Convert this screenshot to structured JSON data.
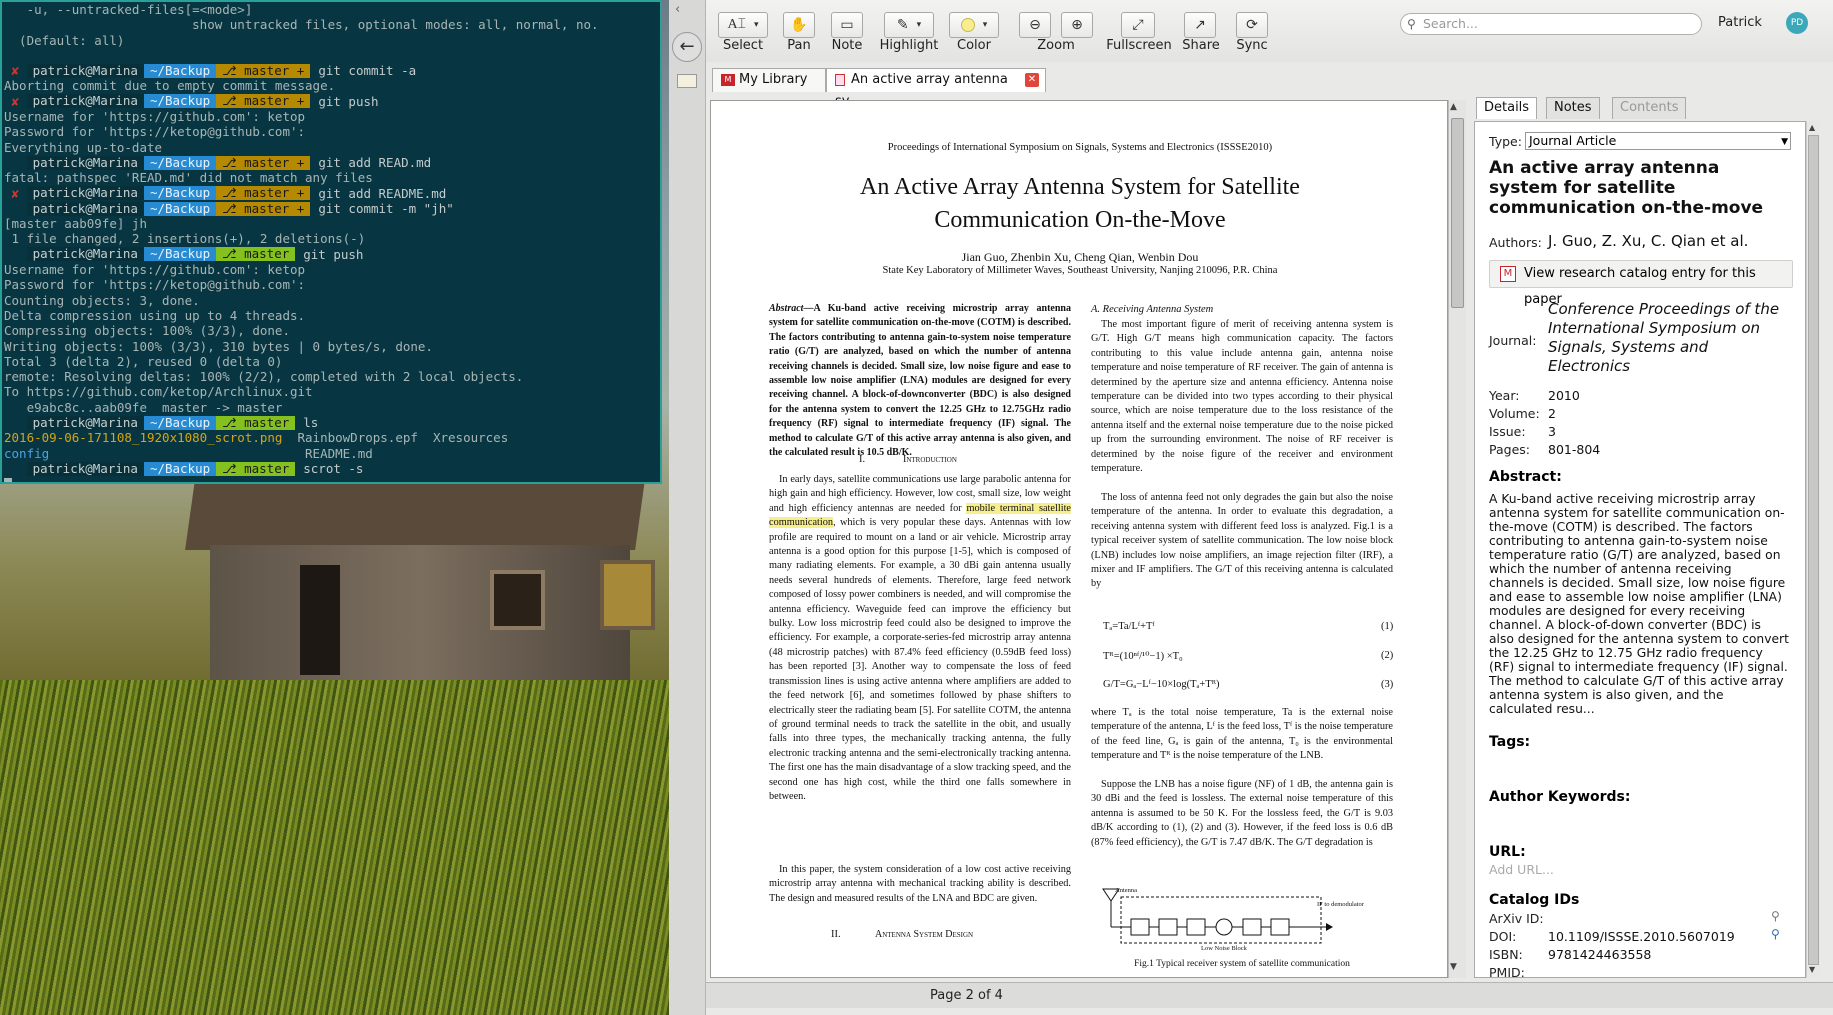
{
  "terminal": {
    "lines": [
      {
        "t": "plain",
        "text": "   -u, --untracked-files[=<mode>]"
      },
      {
        "t": "plain",
        "text": "                         show untracked files, optional modes: all, normal, no."
      },
      {
        "t": "plain",
        "text": "  (Default: all)"
      },
      {
        "t": "plain",
        "text": ""
      },
      {
        "t": "prompt",
        "x": true,
        "user": "patrick@Marina",
        "dir": "~/Backup",
        "branch": "master +",
        "dirty": true,
        "cmd": "git commit -a"
      },
      {
        "t": "plain",
        "text": "Aborting commit due to empty commit message."
      },
      {
        "t": "prompt",
        "x": true,
        "user": "patrick@Marina",
        "dir": "~/Backup",
        "branch": "master +",
        "dirty": true,
        "cmd": "git push"
      },
      {
        "t": "plain",
        "text": "Username for 'https://github.com': ketop"
      },
      {
        "t": "plain",
        "text": "Password for 'https://ketop@github.com':"
      },
      {
        "t": "plain",
        "text": "Everything up-to-date"
      },
      {
        "t": "prompt",
        "x": false,
        "user": "patrick@Marina",
        "dir": "~/Backup",
        "branch": "master +",
        "dirty": true,
        "cmd": "git add READ.md"
      },
      {
        "t": "plain",
        "text": "fatal: pathspec 'READ.md' did not match any files"
      },
      {
        "t": "prompt",
        "x": true,
        "user": "patrick@Marina",
        "dir": "~/Backup",
        "branch": "master +",
        "dirty": true,
        "cmd": "git add README.md"
      },
      {
        "t": "prompt",
        "x": false,
        "user": "patrick@Marina",
        "dir": "~/Backup",
        "branch": "master +",
        "dirty": true,
        "cmd": "git commit -m \"jh\""
      },
      {
        "t": "plain",
        "text": "[master aab09fe] jh"
      },
      {
        "t": "plain",
        "text": " 1 file changed, 2 insertions(+), 2 deletions(-)"
      },
      {
        "t": "prompt",
        "x": false,
        "user": "patrick@Marina",
        "dir": "~/Backup",
        "branch": "master",
        "dirty": false,
        "cmd": "git push"
      },
      {
        "t": "plain",
        "text": "Username for 'https://github.com': ketop"
      },
      {
        "t": "plain",
        "text": "Password for 'https://ketop@github.com':"
      },
      {
        "t": "plain",
        "text": "Counting objects: 3, done."
      },
      {
        "t": "plain",
        "text": "Delta compression using up to 4 threads."
      },
      {
        "t": "plain",
        "text": "Compressing objects: 100% (3/3), done."
      },
      {
        "t": "plain",
        "text": "Writing objects: 100% (3/3), 310 bytes | 0 bytes/s, done."
      },
      {
        "t": "plain",
        "text": "Total 3 (delta 2), reused 0 (delta 0)"
      },
      {
        "t": "plain",
        "text": "remote: Resolving deltas: 100% (2/2), completed with 2 local objects."
      },
      {
        "t": "plain",
        "text": "To https://github.com/ketop/Archlinux.git"
      },
      {
        "t": "plain",
        "text": "   e9abc8c..aab09fe  master -> master"
      },
      {
        "t": "prompt",
        "x": false,
        "user": "patrick@Marina",
        "dir": "~/Backup",
        "branch": "master",
        "dirty": false,
        "cmd": "ls"
      },
      {
        "t": "ls1",
        "a": "2016-09-06-171108_1920x1080_scrot.png",
        "b": "  RainbowDrops.epf  Xresources"
      },
      {
        "t": "ls2",
        "a": "config",
        "b": "                                  README.md"
      },
      {
        "t": "prompt",
        "x": false,
        "user": "patrick@Marina",
        "dir": "~/Backup",
        "branch": "master",
        "dirty": false,
        "cmd": "scrot -s"
      },
      {
        "t": "cursor"
      }
    ]
  },
  "toolbar": {
    "select": "Select",
    "pan": "Pan",
    "note": "Note",
    "highlight": "Highlight",
    "color": "Color",
    "zoom": "Zoom",
    "fullscreen": "Fullscreen",
    "share": "Share",
    "sync": "Sync",
    "search_placeholder": "Search...",
    "user": "Patrick",
    "user_initials": "PD"
  },
  "tabs": {
    "library": "My Library",
    "document": "An active array antenna sy..."
  },
  "status": {
    "page": "Page 2 of 4"
  },
  "paper": {
    "venue": "Proceedings of International Symposium on Signals, Systems and Electronics  (ISSSE2010)",
    "title1": "An Active Array Antenna System for Satellite",
    "title2": "Communication On-the-Move",
    "authors": "Jian Guo, Zhenbin Xu, Cheng Qian, Wenbin Dou",
    "affil": "State Key Laboratory of Millimeter Waves, Southeast University, Nanjing 210096, P.R. China",
    "abstract_lead": "Abstract",
    "abstract": "A Ku-band active receiving microstrip array antenna system for satellite communication on-the-move (COTM) is described.  The factors contributing to antenna gain-to-system noise temperature ratio (G/T) are analyzed, based on which the number of antenna receiving channels is decided.  Small size, low noise figure and ease to assemble low noise amplifier (LNA) modules are designed for every receiving channel.  A block-of-downconverter (BDC) is also designed for the antenna system to convert the 12.25 GHz to 12.75GHz radio frequency (RF) signal to intermediate frequency (IF) signal.  The method to calculate G/T of this active array antenna is also given, and the calculated result is 10.5 dB/K.",
    "sec1_num": "I.",
    "sec1": "Introduction",
    "intro_a": "In early days, satellite communications use large parabolic antenna for high gain and high efficiency.  However, low cost, small size, low weight and high efficiency antennas are needed for ",
    "intro_hl": "mobile terminal satellite communication",
    "intro_b": ", which is very popular these days.  Antennas with low profile are required to mount on a land or air vehicle.  Microstrip array antenna is a good option for this purpose [1-5], which is composed of many radiating elements.  For example, a 30 dBi gain antenna usually needs several hundreds of elements. Therefore, large feed network composed of lossy power combiners is needed, and will compromise the antenna efficiency.  Waveguide feed can improve the efficiency but bulky.  Low loss microstrip feed could also be designed to improve the efficiency.  For example, a corporate-series-fed microstrip array antenna (48 microstrip patches) with 87.4% feed efficiency (0.59dB feed loss) has been reported [3]. Another way to compensate the loss of feed transmission lines is using active antenna where amplifiers are added to the feed network [6], and sometimes followed by phase shifters to electrically steer the radiating beam [5].  For satellite COTM, the antenna of ground terminal needs to track the satellite in the obit, and usually falls into three types, the mechanically tracking antenna, the fully electronic tracking antenna and the semi-electronically tracking antenna.  The first one has the main disadvantage of a slow tracking speed, and the second one has high cost, while the third one falls somewhere in between.",
    "intro_c": "In this paper, the system consideration of a low cost active receiving microstrip array antenna with mechanical tracking ability is described.  The design and measured results of the LNA and BDC are given.",
    "sec2_num": "II.",
    "sec2": "Antenna System Design",
    "subA": "A.   Receiving Antenna System",
    "rc1": "The most important figure of merit of receiving antenna system is G/T.  High G/T means high communication capacity. The factors contributing to this value include antenna gain, antenna noise temperature and noise temperature of RF receiver.  The gain of antenna is determined by the aperture size and antenna efficiency.  Antenna noise temperature can be divided into two types according to their physical source, which are noise temperature due to the loss resistance of the antenna itself and the external noise temperature due to the noise picked up from the surrounding environment.  The noise of RF receiver is determined by the noise figure of the receiver and environment temperature.",
    "rc2": "The loss of antenna feed not only degrades the gain but also the noise temperature of the antenna.  In order to evaluate this degradation, a receiving antenna system with different feed loss is analyzed.  Fig.1 is a typical receiver system of satellite communication.  The low noise block (LNB) includes low noise amplifiers, an image rejection filter (IRF), a mixer and IF amplifiers.  The G/T of this receiving antenna is calculated by",
    "eq1": "Tₐ=Ta/Lᶠ+Tᶠ",
    "eq1n": "(1)",
    "eq2": "Tᴿ=(10ⁿᶠ/¹⁰−1) ×T₀",
    "eq2n": "(2)",
    "eq3": "G/T=Gₐ−Lᶠ−10×log(Tₐ+Tᴿ)",
    "eq3n": "(3)",
    "rc3": "where Tₐ is the total noise temperature, Ta is the external noise temperature of the antenna, Lᶠ is the feed loss, Tᶠ is the noise temperature of the feed line, Gₐ is gain of the antenna, T₀ is the environmental temperature and Tᴿ is the noise temperature of the LNB.",
    "rc4": "Suppose the LNB has a noise figure (NF) of 1 dB, the antenna gain is 30 dBi and the feed is lossless.  The external noise temperature of this antenna is assumed to be 50 K.  For the lossless feed, the G/T is 9.03 dB/K according to (1), (2) and (3).  However, if the feed loss is 0.6 dB (87% feed efficiency), the G/T is 7.47 dB/K.  The G/T degradation is",
    "fig_antenna": "Antenna",
    "fig_if": "IF to demodulator",
    "fig_lnb": "Low Noise Block",
    "fig_caption": "Fig.1 Typical receiver system of satellite communication"
  },
  "details": {
    "tabs": [
      "Details",
      "Notes",
      "Contents"
    ],
    "type_label": "Type:",
    "type_value": "Journal Article",
    "title": "An active array antenna system for satellite communication on-the-move",
    "authors_label": "Authors:",
    "authors": "J. Guo, Z. Xu, C. Qian et al.",
    "catalog_link": "View research catalog entry for this paper",
    "journal_label": "Journal:",
    "journal": "Conference Proceedings of the International Symposium on Signals, Systems and Electronics",
    "year_label": "Year:",
    "year": "2010",
    "volume_label": "Volume:",
    "volume": "2",
    "issue_label": "Issue:",
    "issue": "3",
    "pages_label": "Pages:",
    "pages": "801-804",
    "abstract_label": "Abstract:",
    "abstract": "A Ku-band active receiving microstrip array antenna system for satellite communication on-the-move (COTM) is described. The factors contributing to antenna gain-to-system noise temperature ratio (G/T) are analyzed, based on which the number of antenna receiving channels is decided. Small size, low noise figure and ease to assemble low noise amplifier (LNA) modules are designed for every receiving channel. A block-of-down converter (BDC) is also designed for the antenna system to convert the 12.25 GHz to 12.75 GHz radio frequency (RF) signal to intermediate frequency (IF) signal. The method to calculate G/T of this active array antenna system is also given, and the calculated resu...",
    "tags_label": "Tags:",
    "keywords_label": "Author Keywords:",
    "url_label": "URL:",
    "url_placeholder": "Add URL...",
    "catalog_ids_label": "Catalog IDs",
    "arxiv_label": "ArXiv ID:",
    "arxiv": "",
    "doi_label": "DOI:",
    "doi": "10.1109/ISSSE.2010.5607019",
    "isbn_label": "ISBN:",
    "isbn": "9781424463558",
    "pmid_label": "PMID:"
  },
  "colors": {
    "accent": "#f7ee8c",
    "tab_close": "#e2463b",
    "avatar": "#3aa8b8"
  }
}
